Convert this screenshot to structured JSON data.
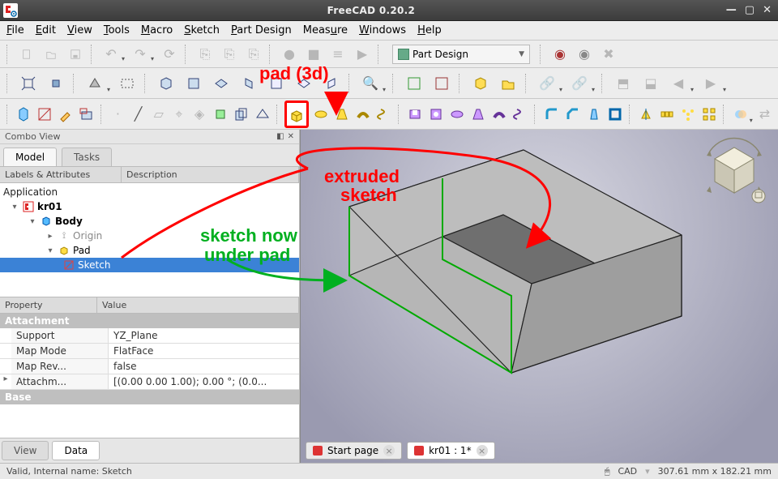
{
  "titlebar": {
    "title": "FreeCAD 0.20.2"
  },
  "menu": {
    "items": [
      "File",
      "Edit",
      "View",
      "Tools",
      "Macro",
      "Sketch",
      "Part Design",
      "Measure",
      "Windows",
      "Help"
    ]
  },
  "toolbar1": {
    "workbench_label": "Part Design"
  },
  "combo": {
    "title": "Combo View",
    "tabs": {
      "model": "Model",
      "tasks": "Tasks"
    },
    "columns": {
      "labels": "Labels & Attributes",
      "desc": "Description"
    },
    "tree": {
      "root": "Application",
      "doc": "kr01",
      "body": "Body",
      "origin": "Origin",
      "pad": "Pad",
      "sketch": "Sketch"
    },
    "prop_cols": {
      "property": "Property",
      "value": "Value"
    },
    "sections": {
      "attachment": "Attachment",
      "base": "Base"
    },
    "props": {
      "support_k": "Support",
      "support_v": "YZ_Plane",
      "mapmode_k": "Map Mode",
      "mapmode_v": "FlatFace",
      "maprev_k": "Map Rev...",
      "maprev_v": "false",
      "attach_k": "Attachm...",
      "attach_v": "[(0.00 0.00 1.00); 0.00 °; (0.0..."
    },
    "bottom_tabs": {
      "view": "View",
      "data": "Data"
    }
  },
  "doc_tabs": {
    "start": "Start page",
    "doc": "kr01 : 1*"
  },
  "status": {
    "left": "Valid, Internal name: Sketch",
    "mode": "CAD",
    "dims": "307.61 mm x 182.21 mm"
  },
  "annotations": {
    "pad3d": "pad (3d)",
    "extruded1": "extruded",
    "extruded2": "sketch",
    "sketchnow1": "sketch now",
    "sketchnow2": "under pad"
  }
}
